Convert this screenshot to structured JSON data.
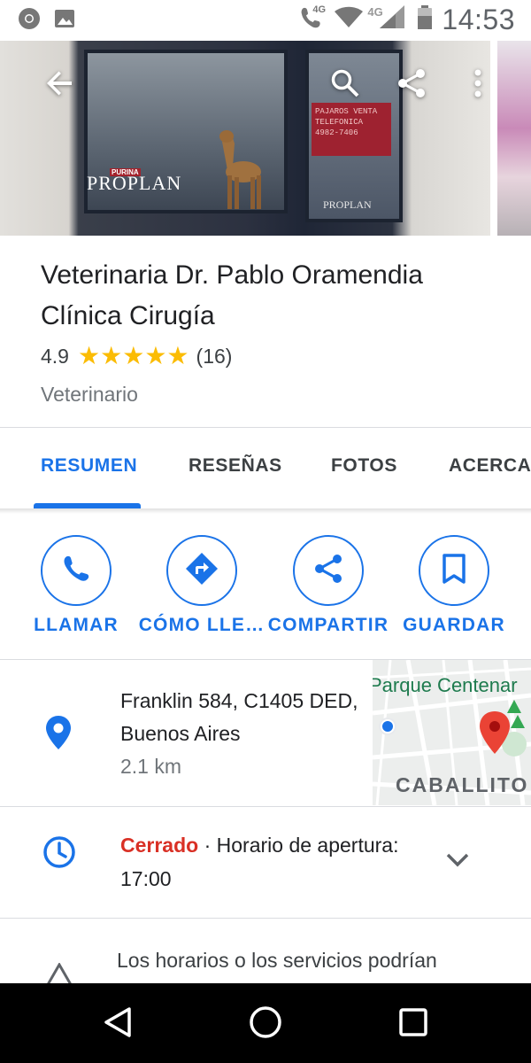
{
  "status_bar": {
    "time": "14:53",
    "network_label_1": "4G",
    "network_label_2": "4G"
  },
  "hero": {
    "brand_text": "PROPLAN",
    "brand_small": "PURINA",
    "brand_text_2": "PROPLAN",
    "sign_lines": "PAJAROS VENTA TELEFONICA 4982-7406",
    "icons": [
      "back-arrow-icon",
      "search-icon",
      "share-icon",
      "more-vert-icon"
    ]
  },
  "place": {
    "title": "Veterinaria Dr. Pablo Oramendia Clínica Cirugía",
    "rating": "4.9",
    "stars": 5,
    "reviews": "(16)",
    "category": "Veterinario"
  },
  "tabs": [
    {
      "label": "RESUMEN",
      "active": true
    },
    {
      "label": "RESEÑAS",
      "active": false
    },
    {
      "label": "FOTOS",
      "active": false
    },
    {
      "label": "ACERCA",
      "active": false
    }
  ],
  "actions": [
    {
      "label": "LLAMAR",
      "icon": "phone-icon"
    },
    {
      "label": "CÓMO LLE…",
      "icon": "directions-icon"
    },
    {
      "label": "COMPARTIR",
      "icon": "share-icon"
    },
    {
      "label": "GUARDAR",
      "icon": "bookmark-icon"
    }
  ],
  "address": {
    "line": "Franklin 584, C1405 DED, Buenos Aires",
    "distance": "2.1 km"
  },
  "map": {
    "label_park": "Parque Centenar",
    "label_area": "CABALLITO"
  },
  "hours": {
    "status": "Cerrado",
    "separator": " · ",
    "detail": "Horario de apertura: 17:00"
  },
  "warning": {
    "text": "Los horarios o los servicios podrían"
  },
  "colors": {
    "accent": "#1a73e8",
    "closed": "#d93025",
    "star": "#fbbc04",
    "map_pin": "#ea4335"
  }
}
